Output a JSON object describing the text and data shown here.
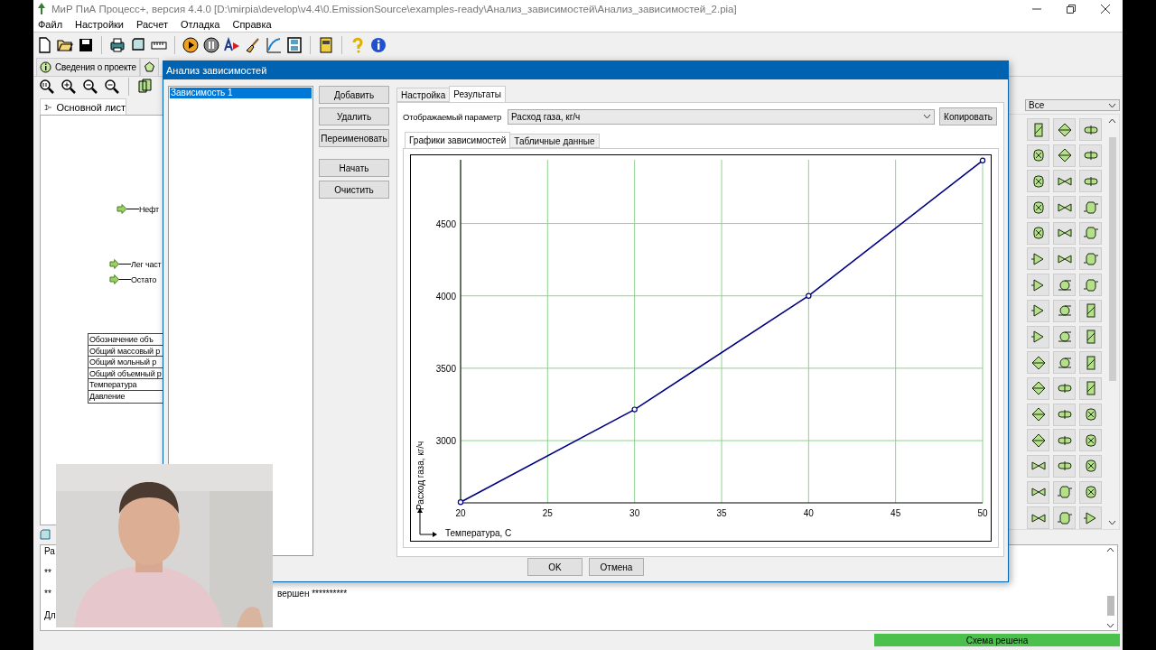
{
  "window": {
    "title": "МиР ПиА Процесс+, версия 4.4.0 [D:\\mirpia\\develop\\v4.4\\0.EmissionSource\\examples-ready\\Анализ_зависимостей\\Анализ_зависимостей_2.pia]"
  },
  "menu": [
    "Файл",
    "Настройки",
    "Расчет",
    "Отладка",
    "Справка"
  ],
  "project_tabs": [
    {
      "label": "Сведения о проекте"
    }
  ],
  "sheet_tab": {
    "label": "Основной лист"
  },
  "diagram": {
    "streams": [
      {
        "label": "Нефт"
      },
      {
        "label": "Лег част"
      },
      {
        "label": "Остато"
      }
    ],
    "table_rows": [
      "Обозначение объ",
      "Общий массовый р",
      "Общий мольный р",
      "Общий объемный р",
      "Температура",
      "Давление"
    ]
  },
  "palette": {
    "filter": "Все"
  },
  "log": [
    {
      "text": "Ра"
    },
    {
      "text": "**"
    },
    {
      "text": "**",
      "tail": "вершен **********"
    },
    {
      "text": "Дл"
    }
  ],
  "status_bar": {
    "message": "Схема решена"
  },
  "dialog": {
    "title": "Анализ зависимостей",
    "items": [
      {
        "label": "Зависимость 1",
        "selected": true
      }
    ],
    "edit_buttons": [
      "Добавить",
      "Удалить",
      "Переименовать"
    ],
    "run_buttons": [
      "Начать",
      "Очистить"
    ],
    "tabs": [
      {
        "label": "Настройка",
        "selected": false
      },
      {
        "label": "Результаты",
        "selected": true
      }
    ],
    "parameter": {
      "label": "Отображаемый параметр",
      "value": "Расход газа, кг/ч"
    },
    "copy_button": "Копировать",
    "view_tabs": [
      {
        "label": "Графики зависимостей",
        "selected": true
      },
      {
        "label": "Табличные данные",
        "selected": false
      }
    ],
    "chart_data": {
      "type": "line",
      "xlabel": "Температура, С",
      "ylabel": "Расход газа, кг/ч",
      "x": [
        20,
        30,
        40,
        50
      ],
      "series": [
        {
          "color": "#000080",
          "marker": "circle",
          "values": [
            2575,
            3215,
            4000,
            4935
          ]
        }
      ],
      "grid": true,
      "xlim": [
        20,
        50
      ],
      "ylim": [
        2570,
        4940
      ],
      "xticks": [
        20,
        25,
        30,
        35,
        40,
        45,
        50
      ],
      "yticks": [
        3000,
        3500,
        4000,
        4500
      ]
    },
    "footer_buttons": [
      "OK",
      "Отмена"
    ]
  }
}
